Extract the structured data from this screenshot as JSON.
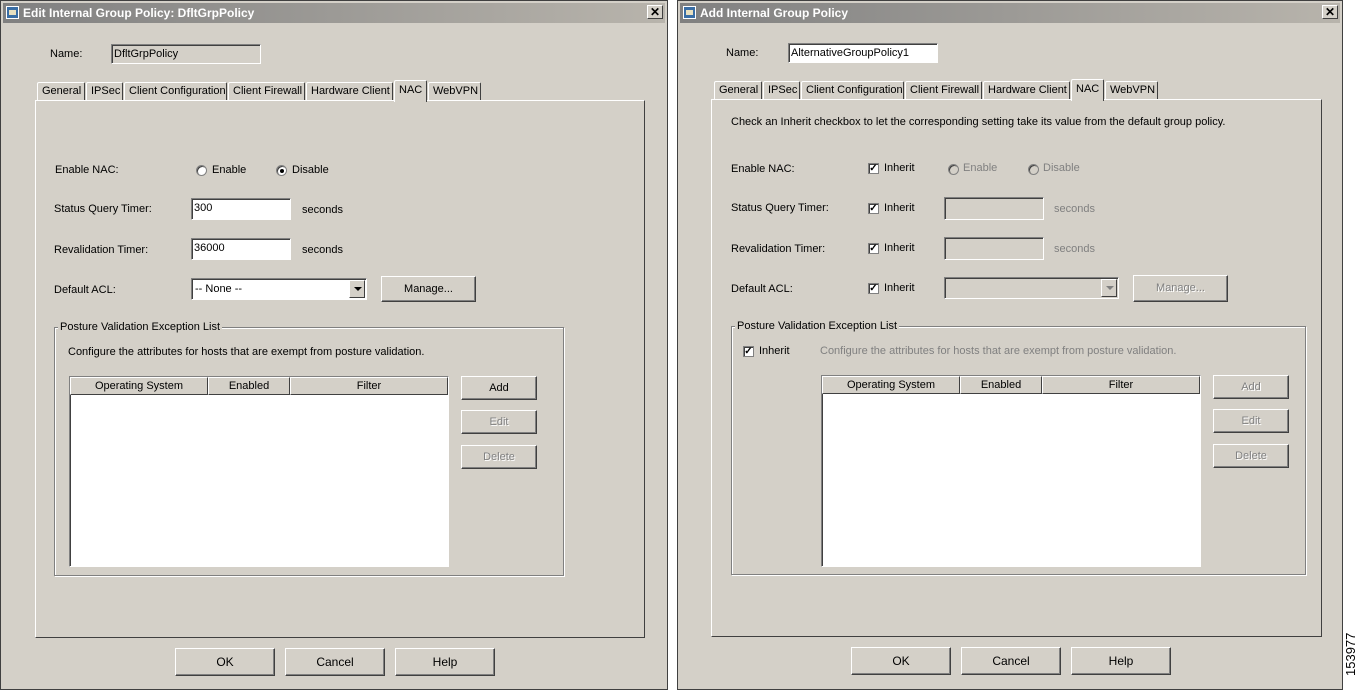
{
  "left_dialog": {
    "title": "Edit Internal Group Policy: DfltGrpPolicy",
    "close_glyph": "✕",
    "name_label": "Name:",
    "name_value": "DfltGrpPolicy",
    "tabs": [
      "General",
      "IPSec",
      "Client Configuration",
      "Client Firewall",
      "Hardware Client",
      "NAC",
      "WebVPN"
    ],
    "active_tab": "NAC",
    "enable_nac_label": "Enable NAC:",
    "enable_label": "Enable",
    "disable_label": "Disable",
    "enable_nac_selected": "Disable",
    "status_query_label": "Status Query Timer:",
    "status_query_value": "300",
    "status_query_unit": "seconds",
    "revalidation_label": "Revalidation Timer:",
    "revalidation_value": "36000",
    "revalidation_unit": "seconds",
    "default_acl_label": "Default ACL:",
    "default_acl_value": "-- None --",
    "manage_label": "Manage...",
    "posture_group_title": "Posture Validation Exception List",
    "posture_description": "Configure the attributes for hosts that are exempt from posture validation.",
    "table_columns": [
      "Operating System",
      "Enabled",
      "Filter"
    ],
    "add_label": "Add",
    "edit_label": "Edit",
    "delete_label": "Delete",
    "ok_label": "OK",
    "cancel_label": "Cancel",
    "help_label": "Help"
  },
  "right_dialog": {
    "title": "Add Internal Group Policy",
    "close_glyph": "✕",
    "name_label": "Name:",
    "name_value": "AlternativeGroupPolicy1",
    "tabs": [
      "General",
      "IPSec",
      "Client Configuration",
      "Client Firewall",
      "Hardware Client",
      "NAC",
      "WebVPN"
    ],
    "active_tab": "NAC",
    "inherit_hint": "Check an Inherit checkbox to let the corresponding setting take its value from the default group policy.",
    "enable_nac_label": "Enable NAC:",
    "inherit_label": "Inherit",
    "enable_label": "Enable",
    "disable_label": "Disable",
    "status_query_label": "Status Query Timer:",
    "status_query_value": "",
    "status_query_unit": "seconds",
    "revalidation_label": "Revalidation Timer:",
    "revalidation_value": "",
    "revalidation_unit": "seconds",
    "default_acl_label": "Default ACL:",
    "default_acl_value": "",
    "manage_label": "Manage...",
    "posture_group_title": "Posture Validation Exception List",
    "posture_description": "Configure the attributes for hosts that are exempt from posture validation.",
    "table_columns": [
      "Operating System",
      "Enabled",
      "Filter"
    ],
    "add_label": "Add",
    "edit_label": "Edit",
    "delete_label": "Delete",
    "ok_label": "OK",
    "cancel_label": "Cancel",
    "help_label": "Help",
    "check_glyph": "✓"
  },
  "figure_id": "153977"
}
